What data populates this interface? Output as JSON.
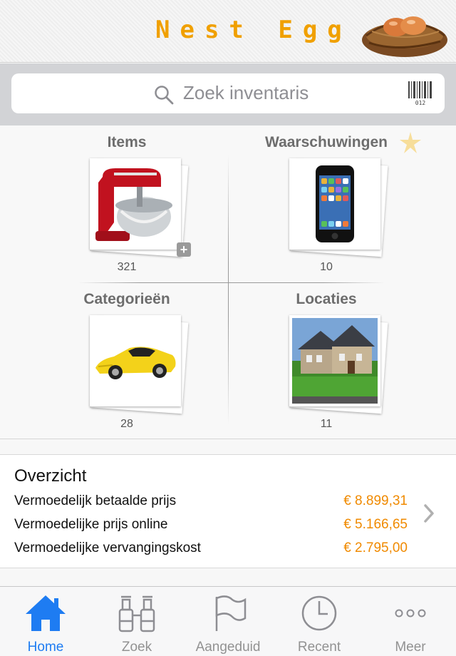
{
  "header": {
    "title": "Nest Egg",
    "logo_icon": "nest-egg-logo"
  },
  "search": {
    "placeholder": "Zoek inventaris",
    "icon": "search-icon",
    "barcode_icon": "barcode-icon",
    "barcode_digits": "012"
  },
  "tiles": [
    {
      "title": "Items",
      "count": "321",
      "image": "kitchen-mixer"
    },
    {
      "title": "Waarschuwingen",
      "count": "10",
      "image": "smartphone"
    },
    {
      "title": "Categorieën",
      "count": "28",
      "image": "yellow-sports-car"
    },
    {
      "title": "Locaties",
      "count": "11",
      "image": "house"
    }
  ],
  "overview": {
    "title": "Overzicht",
    "rows": [
      {
        "label": "Vermoedelijk betaalde prijs",
        "value": "€ 8.899,31"
      },
      {
        "label": "Vermoedelijke prijs online",
        "value": "€ 5.166,65"
      },
      {
        "label": "Vermoedelijke vervangingskost",
        "value": "€ 2.795,00"
      }
    ]
  },
  "tabbar": {
    "active": "Home",
    "tabs": [
      {
        "label": "Home",
        "icon": "home-icon"
      },
      {
        "label": "Zoek",
        "icon": "binoculars-icon"
      },
      {
        "label": "Aangeduid",
        "icon": "flag-icon"
      },
      {
        "label": "Recent",
        "icon": "clock-icon"
      },
      {
        "label": "Meer",
        "icon": "more-icon"
      }
    ]
  },
  "colors": {
    "accent": "#1e7cf2",
    "price": "#f08a00",
    "title": "#f0a000"
  }
}
